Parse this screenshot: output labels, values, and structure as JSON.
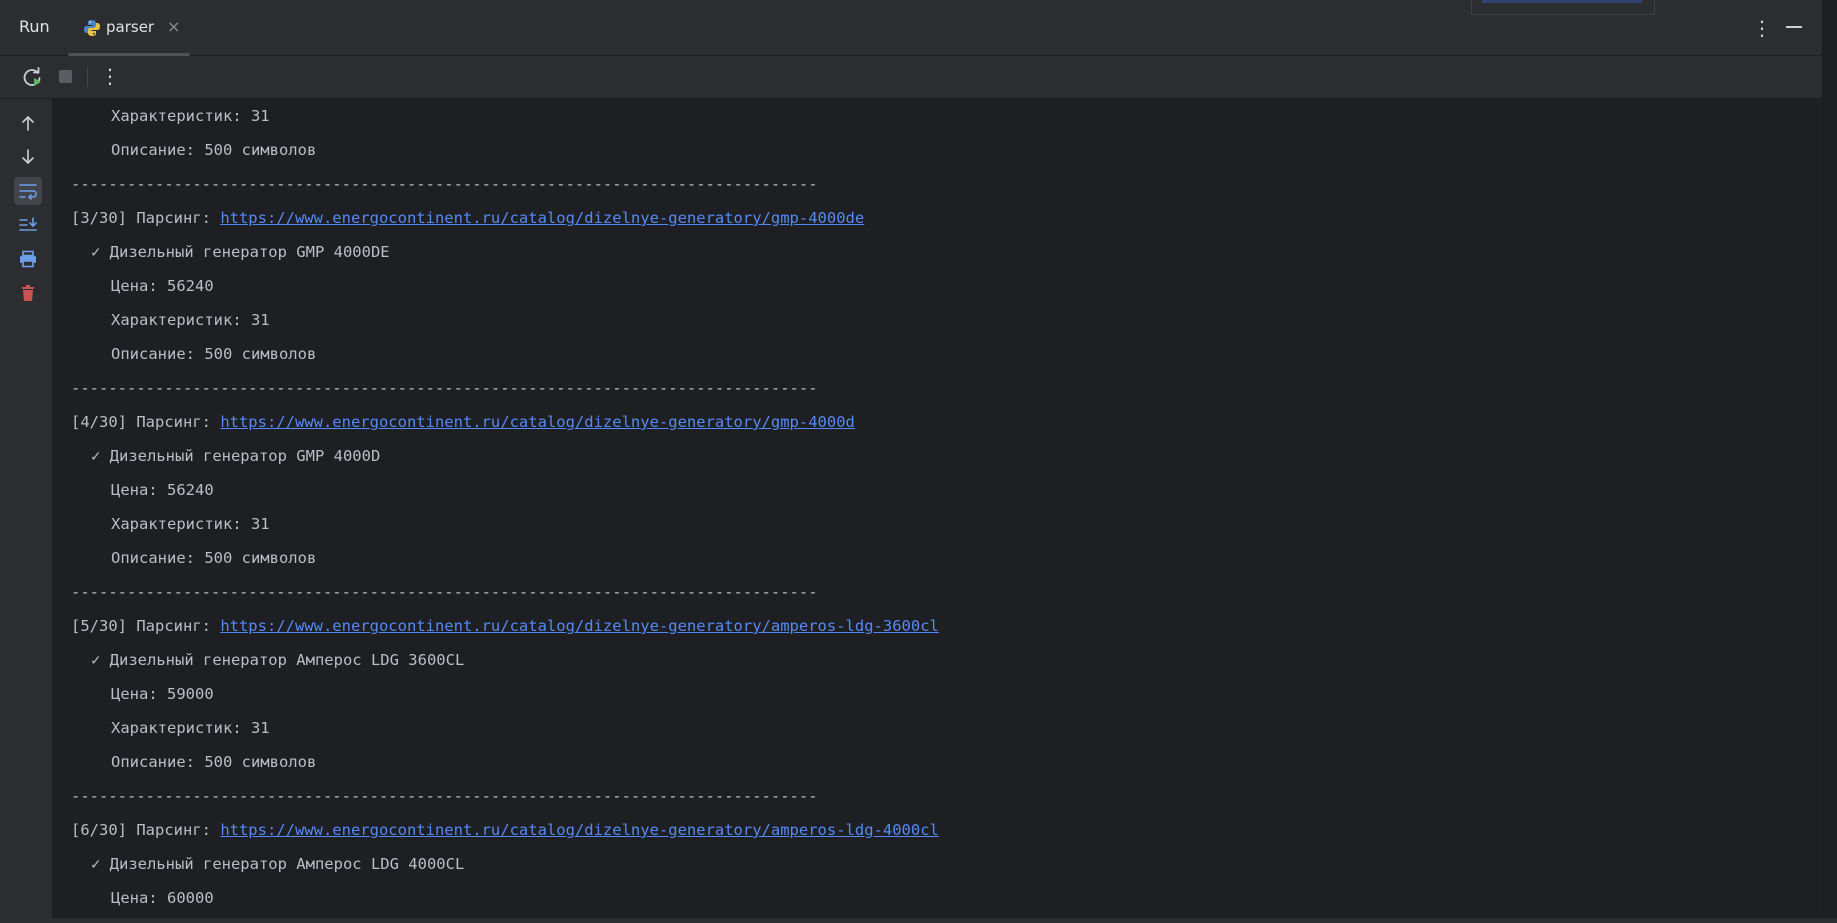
{
  "header": {
    "run_label": "Run",
    "tab": {
      "label": "parser",
      "close": "×",
      "icon": "python-icon"
    },
    "more": "⋮"
  },
  "toolbar": {
    "rerun_icon": "rerun-icon",
    "stop_icon": "stop-icon",
    "more": "⋮"
  },
  "gutter": {
    "icons": [
      "scroll-up-icon",
      "scroll-down-icon",
      "soft-wrap-icon",
      "scroll-to-end-icon",
      "print-icon",
      "clear-all-icon"
    ]
  },
  "console": {
    "lines": [
      {
        "kind": "indent",
        "text": "Характеристик: 31"
      },
      {
        "kind": "indent",
        "text": "Описание: 500 символов"
      },
      {
        "kind": "sep",
        "text": "--------------------------------------------------------------------------------"
      },
      {
        "kind": "parse",
        "prefix": "[3/30] Парсинг: ",
        "url": "https://www.energocontinent.ru/catalog/dizelnye-generatory/gmp-4000de"
      },
      {
        "kind": "check",
        "text": "✓ Дизельный генератор GMP 4000DE"
      },
      {
        "kind": "indent",
        "text": "Цена: 56240"
      },
      {
        "kind": "indent",
        "text": "Характеристик: 31"
      },
      {
        "kind": "indent",
        "text": "Описание: 500 символов"
      },
      {
        "kind": "sep",
        "text": "--------------------------------------------------------------------------------"
      },
      {
        "kind": "parse",
        "prefix": "[4/30] Парсинг: ",
        "url": "https://www.energocontinent.ru/catalog/dizelnye-generatory/gmp-4000d"
      },
      {
        "kind": "check",
        "text": "✓ Дизельный генератор GMP 4000D"
      },
      {
        "kind": "indent",
        "text": "Цена: 56240"
      },
      {
        "kind": "indent",
        "text": "Характеристик: 31"
      },
      {
        "kind": "indent",
        "text": "Описание: 500 символов"
      },
      {
        "kind": "sep",
        "text": "--------------------------------------------------------------------------------"
      },
      {
        "kind": "parse",
        "prefix": "[5/30] Парсинг: ",
        "url": "https://www.energocontinent.ru/catalog/dizelnye-generatory/amperos-ldg-3600cl"
      },
      {
        "kind": "check",
        "text": "✓ Дизельный генератор Амперос LDG 3600CL"
      },
      {
        "kind": "indent",
        "text": "Цена: 59000"
      },
      {
        "kind": "indent",
        "text": "Характеристик: 31"
      },
      {
        "kind": "indent",
        "text": "Описание: 500 символов"
      },
      {
        "kind": "sep",
        "text": "--------------------------------------------------------------------------------"
      },
      {
        "kind": "parse",
        "prefix": "[6/30] Парсинг: ",
        "url": "https://www.energocontinent.ru/catalog/dizelnye-generatory/amperos-ldg-4000cl"
      },
      {
        "kind": "check",
        "text": "✓ Дизельный генератор Амперос LDG 4000CL"
      },
      {
        "kind": "indent",
        "text": "Цена: 60000"
      }
    ]
  },
  "colors": {
    "background": "#1e1f22",
    "panel": "#2b2d30",
    "text": "#bcbec4",
    "link": "#548af7",
    "clear_icon": "#c75450",
    "rerun_icon": "#5fb865"
  }
}
